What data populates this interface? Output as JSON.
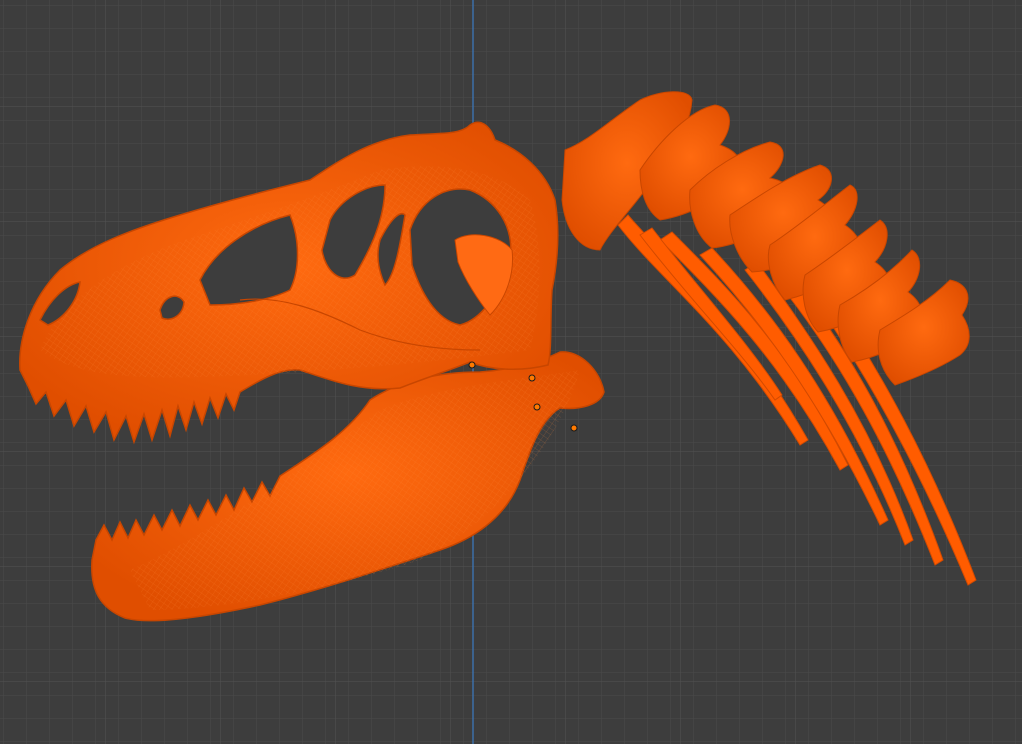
{
  "viewport": {
    "background_color": "#3d3d3d",
    "grid_minor_color": "#4a4a4a",
    "grid_major_color": "#535353",
    "y_axis_color": "#3d6fa8"
  },
  "model": {
    "name": "trex-skeleton-mesh",
    "parts": [
      "skull",
      "lower-jaw",
      "neck-vertebrae",
      "cervical-ribs"
    ],
    "display": "wireframe-selected",
    "selection_color": "#ff5f00",
    "wire_color": "#ff7a24",
    "edge_color": "#c94800"
  },
  "object_origins": {
    "count": 4,
    "color": "#ff7a00"
  }
}
